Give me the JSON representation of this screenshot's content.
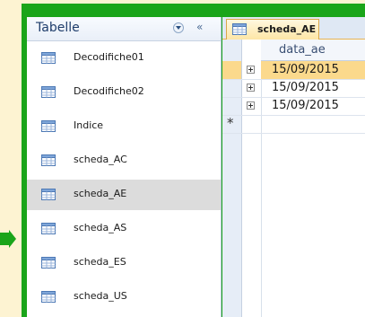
{
  "navigation_pane": {
    "title": "Tabelle",
    "menu_icon": "chevron-down-icon",
    "collapse_label": "«",
    "items": [
      {
        "label": "Decodifiche01",
        "icon": "table-icon",
        "selected": false
      },
      {
        "label": "Decodifiche02",
        "icon": "table-icon",
        "selected": false
      },
      {
        "label": "Indice",
        "icon": "table-icon",
        "selected": false
      },
      {
        "label": "scheda_AC",
        "icon": "table-icon",
        "selected": false
      },
      {
        "label": "scheda_AE",
        "icon": "table-icon",
        "selected": true
      },
      {
        "label": "scheda_AS",
        "icon": "table-icon",
        "selected": false
      },
      {
        "label": "scheda_ES",
        "icon": "table-icon",
        "selected": false
      },
      {
        "label": "scheda_US",
        "icon": "table-icon",
        "selected": false
      }
    ]
  },
  "document": {
    "tab_label": "scheda_AE",
    "column_header": "data_ae",
    "rows": [
      {
        "value": "15/09/2015",
        "current": true
      },
      {
        "value": "15/09/2015",
        "current": false
      },
      {
        "value": "15/09/2015",
        "current": false
      }
    ],
    "new_record_marker": "*"
  },
  "colors": {
    "frame": "#1aa51a",
    "arrow": "#1aa51a",
    "background": "#fdf3d2",
    "selection": "#dcdcdc",
    "current_row": "#fbd98c"
  }
}
